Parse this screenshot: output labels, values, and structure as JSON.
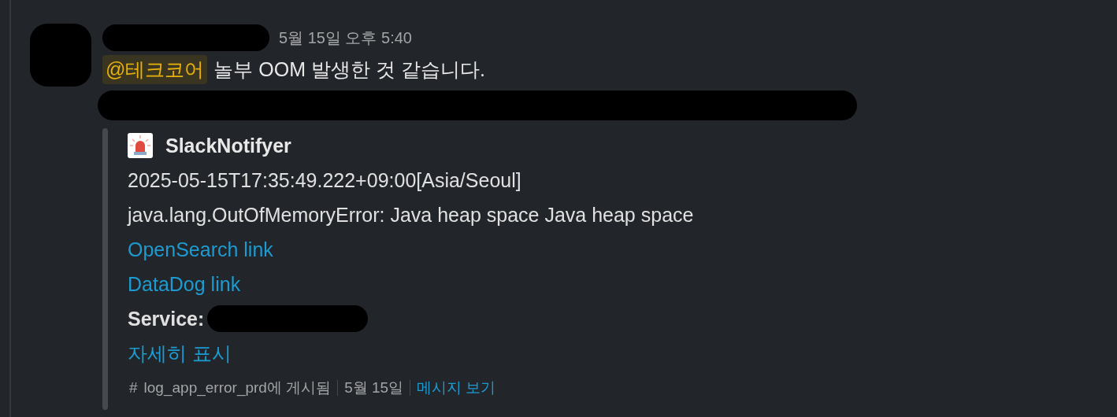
{
  "message": {
    "timestamp": "5월 15일 오후 5:40",
    "mention": "@테크코어",
    "text": "놀부 OOM 발생한 것 같습니다."
  },
  "attachment": {
    "app_name": "SlackNotifyer",
    "lines": [
      {
        "kind": "text",
        "text": "2025-05-15T17:35:49.222+09:00[Asia/Seoul]"
      },
      {
        "kind": "text",
        "text": "java.lang.OutOfMemoryError: Java heap space Java heap space"
      },
      {
        "kind": "link",
        "text": "OpenSearch link"
      },
      {
        "kind": "link",
        "text": "DataDog link"
      },
      {
        "kind": "field",
        "text": "Service:"
      }
    ],
    "show_more": "자세히 표시",
    "footer": {
      "hash": "#",
      "channel": "log_app_error_prd에 게시됨",
      "date": "5월 15일",
      "view_link": "메시지 보기"
    }
  }
}
